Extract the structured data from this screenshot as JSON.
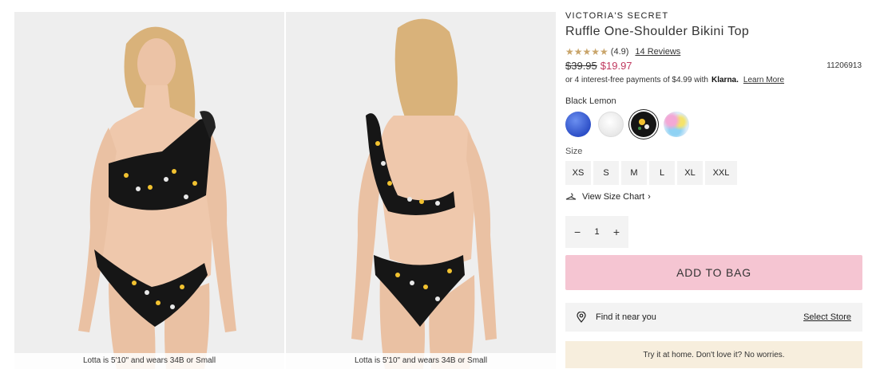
{
  "images": {
    "front_caption": "Lotta is 5'10\" and wears 34B or Small",
    "back_caption": "Lotta is 5'10\" and wears 34B or Small"
  },
  "product": {
    "brand": "VICTORIA'S SECRET",
    "title": "Ruffle One-Shoulder Bikini Top",
    "stars": "★★★★★",
    "rating": "(4.9)",
    "reviews_link": "14 Reviews",
    "original_price": "$39.95",
    "sale_price": "$19.97",
    "sku": "11206913",
    "klarna_text": "or 4 interest-free payments of $4.99 with",
    "klarna_brand": "Klarna.",
    "learn_more": "Learn More",
    "color_name": "Black Lemon",
    "swatches": [
      "blue",
      "white",
      "black-lemon",
      "pastel-print"
    ],
    "size_label": "Size",
    "sizes": [
      "XS",
      "S",
      "M",
      "L",
      "XL",
      "XXL"
    ],
    "size_chart_link": "View Size Chart",
    "quantity": "1",
    "add_to_bag": "ADD TO BAG",
    "find_store_text": "Find it near you",
    "select_store": "Select Store",
    "try_banner": "Try it at home. Don't love it? No worries."
  },
  "colors": {
    "sale_price": "#c0395f",
    "add_to_bag_bg": "#f5c5d2",
    "star": "#c9a56b",
    "try_banner_bg": "#f7eedd"
  }
}
